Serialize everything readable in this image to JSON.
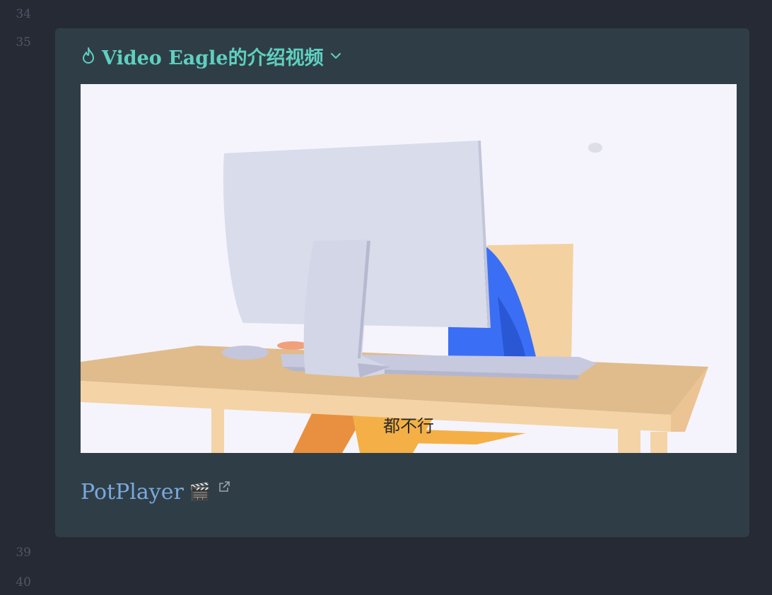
{
  "line_numbers": {
    "top": [
      "34",
      "35"
    ],
    "bottom": [
      "39",
      "40"
    ]
  },
  "callout": {
    "title": "Video Eagle的介绍视频",
    "icon": "fire-icon",
    "collapse_icon": "chevron-down-icon",
    "video": {
      "subtitle": "都不行"
    },
    "link": {
      "label": "PotPlayer",
      "emoji": "🎬",
      "external_icon": "external-link-icon"
    }
  },
  "colors": {
    "background": "#262a34",
    "callout_bg": "#2f3e46",
    "title": "#5fd0c0",
    "link": "#7aa9e0"
  }
}
